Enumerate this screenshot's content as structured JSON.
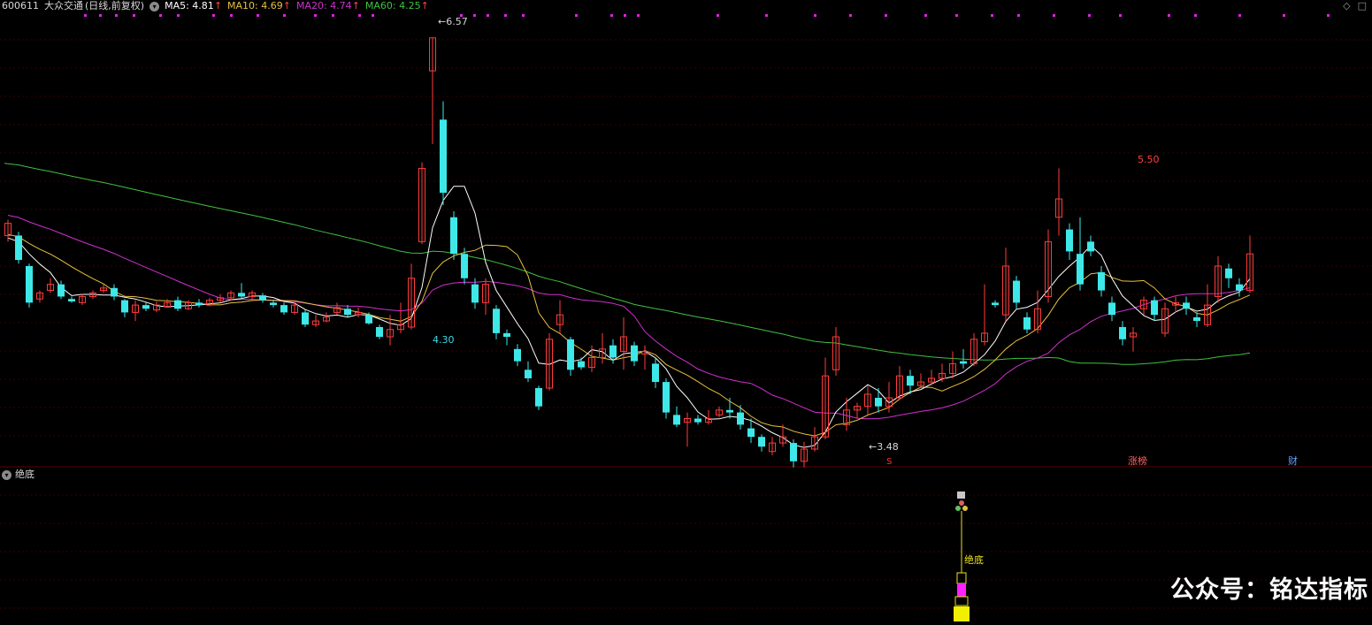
{
  "header": {
    "code": "600611",
    "name": "大众交通",
    "mode": "(日线,前复权)",
    "ma": [
      {
        "label": "MA5: 4.81",
        "color": "#ffffff"
      },
      {
        "label": "MA10: 4.69",
        "color": "#e8c040"
      },
      {
        "label": "MA20: 4.74",
        "color": "#d030d0"
      },
      {
        "label": "MA60: 4.25",
        "color": "#40c040"
      }
    ],
    "up_arrow": "↑",
    "collapse_glyph": "▾"
  },
  "sub_panel": {
    "title": "绝底",
    "signal_label": "绝底"
  },
  "annotations": {
    "high": "6.57",
    "low1": "4.30",
    "low2": "←3.48",
    "peak2": "5.50",
    "mark_s": "S",
    "mark_zhangbang": "涨榜",
    "mark_cai": "财"
  },
  "corner": {
    "diamond": "◇",
    "square": "□"
  },
  "watermark": "公众号：铭达指标",
  "colors": {
    "bg": "#000000",
    "up": "#ff3c3c",
    "down": "#3ee8e8",
    "ma5": "#ffffff",
    "ma10": "#e8c040",
    "ma20": "#d030d0",
    "ma60": "#40c040",
    "grid": "#3a0000",
    "dot": "#e020e0"
  },
  "chart_data": {
    "type": "candlestick",
    "y_range": [
      3.2,
      6.75
    ],
    "candles": [
      [
        4.95,
        5.05,
        4.95,
        5.08,
        4.9
      ],
      [
        4.95,
        4.75,
        4.75,
        4.98,
        4.72
      ],
      [
        4.7,
        4.4,
        4.4,
        4.72,
        4.36
      ],
      [
        4.43,
        4.48,
        4.48,
        4.5,
        4.4
      ],
      [
        4.5,
        4.55,
        4.55,
        4.6,
        4.48
      ],
      [
        4.55,
        4.45,
        4.45,
        4.58,
        4.43
      ],
      [
        4.43,
        4.41,
        4.41,
        4.45,
        4.4
      ],
      [
        4.4,
        4.45,
        4.45,
        4.47,
        4.38
      ],
      [
        4.45,
        4.48,
        4.48,
        4.5,
        4.43
      ],
      [
        4.5,
        4.52,
        4.52,
        4.55,
        4.48
      ],
      [
        4.52,
        4.45,
        4.45,
        4.55,
        4.42
      ],
      [
        4.42,
        4.32,
        4.32,
        4.43,
        4.28
      ],
      [
        4.32,
        4.38,
        4.38,
        4.42,
        4.25
      ],
      [
        4.38,
        4.35,
        4.35,
        4.4,
        4.33
      ],
      [
        4.34,
        4.38,
        4.38,
        4.41,
        4.32
      ],
      [
        4.37,
        4.4,
        4.4,
        4.43,
        4.36
      ],
      [
        4.42,
        4.35,
        4.35,
        4.45,
        4.33
      ],
      [
        4.35,
        4.4,
        4.4,
        4.42,
        4.34
      ],
      [
        4.4,
        4.38,
        4.38,
        4.43,
        4.36
      ],
      [
        4.38,
        4.42,
        4.42,
        4.44,
        4.37
      ],
      [
        4.42,
        4.44,
        4.44,
        4.47,
        4.4
      ],
      [
        4.44,
        4.48,
        4.48,
        4.5,
        4.42
      ],
      [
        4.48,
        4.45,
        4.45,
        4.56,
        4.43
      ],
      [
        4.45,
        4.48,
        4.48,
        4.5,
        4.42
      ],
      [
        4.46,
        4.42,
        4.42,
        4.48,
        4.4
      ],
      [
        4.4,
        4.38,
        4.38,
        4.42,
        4.36
      ],
      [
        4.38,
        4.32,
        4.32,
        4.4,
        4.3
      ],
      [
        4.32,
        4.38,
        4.38,
        4.42,
        4.3
      ],
      [
        4.32,
        4.22,
        4.22,
        4.34,
        4.2
      ],
      [
        4.22,
        4.25,
        4.25,
        4.3,
        4.2
      ],
      [
        4.25,
        4.28,
        4.28,
        4.32,
        4.24
      ],
      [
        4.32,
        4.36,
        4.36,
        4.4,
        4.3
      ],
      [
        4.35,
        4.3,
        4.3,
        4.38,
        4.28
      ],
      [
        4.3,
        4.32,
        4.32,
        4.36,
        4.28
      ],
      [
        4.3,
        4.23,
        4.23,
        4.32,
        4.22
      ],
      [
        4.2,
        4.12,
        4.12,
        4.22,
        4.1
      ],
      [
        4.12,
        4.18,
        4.18,
        4.3,
        4.05
      ],
      [
        4.18,
        4.22,
        4.22,
        4.4,
        4.15
      ],
      [
        4.2,
        4.6,
        4.6,
        4.72,
        4.18
      ],
      [
        4.9,
        5.5,
        5.5,
        5.55,
        4.88
      ],
      [
        6.3,
        6.57,
        6.57,
        6.57,
        5.7
      ],
      [
        5.9,
        5.3,
        5.3,
        6.05,
        5.2
      ],
      [
        5.1,
        4.8,
        4.8,
        5.15,
        4.75
      ],
      [
        4.8,
        4.6,
        4.6,
        4.85,
        4.55
      ],
      [
        4.55,
        4.4,
        4.4,
        4.6,
        4.35
      ],
      [
        4.4,
        4.55,
        4.55,
        4.6,
        4.3
      ],
      [
        4.35,
        4.15,
        4.15,
        4.38,
        4.1
      ],
      [
        4.15,
        4.12,
        4.12,
        4.18,
        4.05
      ],
      [
        4.02,
        3.92,
        3.92,
        4.06,
        3.88
      ],
      [
        3.85,
        3.78,
        3.78,
        3.92,
        3.75
      ],
      [
        3.7,
        3.55,
        3.55,
        3.72,
        3.52
      ],
      [
        3.7,
        4.1,
        4.1,
        4.15,
        3.68
      ],
      [
        4.22,
        4.3,
        4.3,
        4.42,
        4.15
      ],
      [
        4.1,
        3.85,
        3.85,
        4.12,
        3.8
      ],
      [
        3.92,
        3.87,
        3.87,
        3.95,
        3.85
      ],
      [
        3.87,
        3.95,
        3.95,
        4.05,
        3.83
      ],
      [
        3.95,
        4.02,
        4.02,
        4.15,
        3.9
      ],
      [
        4.05,
        3.95,
        3.95,
        4.1,
        3.9
      ],
      [
        4.0,
        4.12,
        4.12,
        4.28,
        3.85
      ],
      [
        4.05,
        3.92,
        3.92,
        4.08,
        3.88
      ],
      [
        3.98,
        4.0,
        4.0,
        4.05,
        3.85
      ],
      [
        3.9,
        3.75,
        3.75,
        3.95,
        3.7
      ],
      [
        3.75,
        3.5,
        3.5,
        3.78,
        3.45
      ],
      [
        3.48,
        3.4,
        3.4,
        3.55,
        3.38
      ],
      [
        3.42,
        3.45,
        3.45,
        3.5,
        3.22
      ],
      [
        3.45,
        3.42,
        3.42,
        3.48,
        3.4
      ],
      [
        3.42,
        3.45,
        3.45,
        3.52,
        3.4
      ],
      [
        3.48,
        3.52,
        3.52,
        3.55,
        3.46
      ],
      [
        3.52,
        3.5,
        3.5,
        3.62,
        3.45
      ],
      [
        3.5,
        3.4,
        3.4,
        3.56,
        3.36
      ],
      [
        3.37,
        3.3,
        3.3,
        3.45,
        3.25
      ],
      [
        3.3,
        3.22,
        3.22,
        3.32,
        3.18
      ],
      [
        3.18,
        3.25,
        3.25,
        3.3,
        3.15
      ],
      [
        3.25,
        3.3,
        3.3,
        3.4,
        3.22
      ],
      [
        3.25,
        3.1,
        3.1,
        3.28,
        3.05
      ],
      [
        3.1,
        3.2,
        3.2,
        3.26,
        3.05
      ],
      [
        3.2,
        3.3,
        3.3,
        3.38,
        3.18
      ],
      [
        3.3,
        3.8,
        3.8,
        3.95,
        3.28
      ],
      [
        3.85,
        4.12,
        4.12,
        4.2,
        3.8
      ],
      [
        3.4,
        3.52,
        3.52,
        3.62,
        3.35
      ],
      [
        3.52,
        3.55,
        3.55,
        3.58,
        3.45
      ],
      [
        3.55,
        3.65,
        3.65,
        3.72,
        3.48
      ],
      [
        3.62,
        3.55,
        3.55,
        3.7,
        3.5
      ],
      [
        3.55,
        3.62,
        3.62,
        3.75,
        3.5
      ],
      [
        3.62,
        3.8,
        3.8,
        3.88,
        3.6
      ],
      [
        3.8,
        3.72,
        3.72,
        3.85,
        3.65
      ],
      [
        3.72,
        3.75,
        3.75,
        3.82,
        3.7
      ],
      [
        3.75,
        3.78,
        3.78,
        3.85,
        3.72
      ],
      [
        3.78,
        3.82,
        3.82,
        3.9,
        3.75
      ],
      [
        3.82,
        3.9,
        3.9,
        4.0,
        3.78
      ],
      [
        3.92,
        3.9,
        3.9,
        4.02,
        3.86
      ],
      [
        3.9,
        4.1,
        4.1,
        4.15,
        3.88
      ],
      [
        4.08,
        4.15,
        4.15,
        4.55,
        4.05
      ],
      [
        4.4,
        4.38,
        4.38,
        4.42,
        4.36
      ],
      [
        4.3,
        4.7,
        4.7,
        4.85,
        4.25
      ],
      [
        4.58,
        4.4,
        4.4,
        4.62,
        4.35
      ],
      [
        4.28,
        4.18,
        4.18,
        4.32,
        4.15
      ],
      [
        4.18,
        4.35,
        4.35,
        4.5,
        4.15
      ],
      [
        4.45,
        4.9,
        4.9,
        5.0,
        4.4
      ],
      [
        5.1,
        5.25,
        5.25,
        5.5,
        4.95
      ],
      [
        5.0,
        4.82,
        4.82,
        5.05,
        4.75
      ],
      [
        4.8,
        4.55,
        4.55,
        5.1,
        4.5
      ],
      [
        4.9,
        4.82,
        4.82,
        4.95,
        4.78
      ],
      [
        4.65,
        4.5,
        4.5,
        4.7,
        4.45
      ],
      [
        4.4,
        4.3,
        4.3,
        4.45,
        4.25
      ],
      [
        4.2,
        4.1,
        4.1,
        4.25,
        4.05
      ],
      [
        4.12,
        4.15,
        4.15,
        4.2,
        4.0
      ],
      [
        4.35,
        4.42,
        4.42,
        4.45,
        4.3
      ],
      [
        4.42,
        4.3,
        4.3,
        4.45,
        4.25
      ],
      [
        4.15,
        4.35,
        4.35,
        4.4,
        4.12
      ],
      [
        4.38,
        4.4,
        4.4,
        4.45,
        4.32
      ],
      [
        4.4,
        4.35,
        4.35,
        4.45,
        4.3
      ],
      [
        4.28,
        4.25,
        4.25,
        4.32,
        4.2
      ],
      [
        4.22,
        4.38,
        4.38,
        4.55,
        4.2
      ],
      [
        4.45,
        4.7,
        4.7,
        4.78,
        4.4
      ],
      [
        4.68,
        4.6,
        4.6,
        4.72,
        4.52
      ],
      [
        4.55,
        4.5,
        4.5,
        4.6,
        4.45
      ],
      [
        4.5,
        4.8,
        4.8,
        4.95,
        4.48
      ]
    ]
  }
}
